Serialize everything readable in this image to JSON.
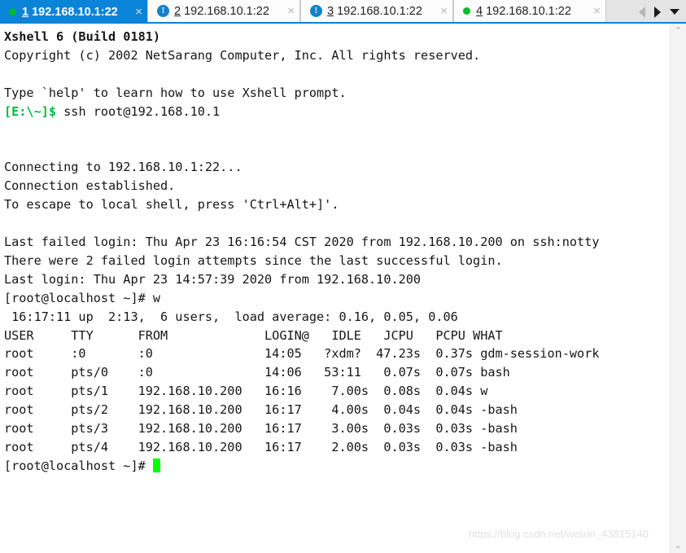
{
  "app": {
    "name": "Xshell",
    "version_line": "Xshell 6 (Build 0181)"
  },
  "tabs": [
    {
      "index": "1",
      "title": "192.168.10.1:22",
      "state": "connected",
      "icon": "green-dot-icon",
      "active": true,
      "close_label": "×"
    },
    {
      "index": "2",
      "title": "192.168.10.1:22",
      "state": "alert",
      "icon": "alert-circle-icon",
      "active": false,
      "close_label": "×"
    },
    {
      "index": "3",
      "title": "192.168.10.1:22",
      "state": "alert",
      "icon": "alert-circle-icon",
      "active": false,
      "close_label": "×"
    },
    {
      "index": "4",
      "title": "192.168.10.1:22",
      "state": "connected",
      "icon": "green-dot-icon",
      "active": false,
      "close_label": "×"
    }
  ],
  "tab_nav": {
    "prev_label": "◀",
    "next_label": "▶",
    "list_label": "▼"
  },
  "terminal": {
    "lines": [
      {
        "text": "Xshell 6 (Build 0181)",
        "style": "bold"
      },
      {
        "text": "Copyright (c) 2002 NetSarang Computer, Inc. All rights reserved.",
        "style": "normal"
      },
      {
        "text": "",
        "style": "normal"
      },
      {
        "text": "Type `help' to learn how to use Xshell prompt.",
        "style": "normal"
      },
      {
        "text": "[E:\\~]$ ",
        "style": "prompt",
        "suffix": "ssh root@192.168.10.1"
      },
      {
        "text": "",
        "style": "normal"
      },
      {
        "text": "",
        "style": "normal"
      },
      {
        "text": "Connecting to 192.168.10.1:22...",
        "style": "normal"
      },
      {
        "text": "Connection established.",
        "style": "normal"
      },
      {
        "text": "To escape to local shell, press 'Ctrl+Alt+]'.",
        "style": "normal"
      },
      {
        "text": "",
        "style": "normal"
      },
      {
        "text": "Last failed login: Thu Apr 23 16:16:54 CST 2020 from 192.168.10.200 on ssh:notty",
        "style": "normal"
      },
      {
        "text": "There were 2 failed login attempts since the last successful login.",
        "style": "normal"
      },
      {
        "text": "Last login: Thu Apr 23 14:57:39 2020 from 192.168.10.200",
        "style": "normal"
      },
      {
        "text": "[root@localhost ~]# w",
        "style": "normal"
      },
      {
        "text": " 16:17:11 up  2:13,  6 users,  load average: 0.16, 0.05, 0.06",
        "style": "normal"
      },
      {
        "text": "USER     TTY      FROM             LOGIN@   IDLE   JCPU   PCPU WHAT",
        "style": "normal"
      },
      {
        "text": "root     :0       :0               14:05   ?xdm?  47.23s  0.37s gdm-session-work",
        "style": "normal"
      },
      {
        "text": "root     pts/0    :0               14:06   53:11   0.07s  0.07s bash",
        "style": "normal"
      },
      {
        "text": "root     pts/1    192.168.10.200   16:16    7.00s  0.08s  0.04s w",
        "style": "normal"
      },
      {
        "text": "root     pts/2    192.168.10.200   16:17    4.00s  0.04s  0.04s -bash",
        "style": "normal"
      },
      {
        "text": "root     pts/3    192.168.10.200   16:17    3.00s  0.03s  0.03s -bash",
        "style": "normal"
      },
      {
        "text": "root     pts/4    192.168.10.200   16:17    2.00s  0.03s  0.03s -bash",
        "style": "normal"
      },
      {
        "text": "[root@localhost ~]# ",
        "style": "cursor"
      }
    ],
    "prompt_local": "[E:\\~]$",
    "command_ssh": "ssh root@192.168.10.1",
    "prompt_remote": "[root@localhost ~]#",
    "command_w": "w",
    "uptime_line": " 16:17:11 up  2:13,  6 users,  load average: 0.16, 0.05, 0.06",
    "w_headers": [
      "USER",
      "TTY",
      "FROM",
      "LOGIN@",
      "IDLE",
      "JCPU",
      "PCPU",
      "WHAT"
    ],
    "w_rows": [
      [
        "root",
        ":0",
        ":0",
        "14:05",
        "?xdm?",
        "47.23s",
        "0.37s",
        "gdm-session-work"
      ],
      [
        "root",
        "pts/0",
        ":0",
        "14:06",
        "53:11",
        "0.07s",
        "0.07s",
        "bash"
      ],
      [
        "root",
        "pts/1",
        "192.168.10.200",
        "16:16",
        "7.00s",
        "0.08s",
        "0.04s",
        "w"
      ],
      [
        "root",
        "pts/2",
        "192.168.10.200",
        "16:17",
        "4.00s",
        "0.04s",
        "0.04s",
        "-bash"
      ],
      [
        "root",
        "pts/3",
        "192.168.10.200",
        "16:17",
        "3.00s",
        "0.03s",
        "0.03s",
        "-bash"
      ],
      [
        "root",
        "pts/4",
        "192.168.10.200",
        "16:17",
        "2.00s",
        "0.03s",
        "0.03s",
        "-bash"
      ]
    ]
  },
  "scrollbar": {
    "up_label": "⌃",
    "down_label": "⌄"
  },
  "watermark": {
    "text": "https://blog.csdn.net/weixin_43815140"
  },
  "colors": {
    "tab_active_bg": "#0a84d8",
    "tab_inactive_bg": "#fcfcfc",
    "tab_bar_bg": "#e4e4e4",
    "connected_dot": "#00bb2d",
    "alert_icon": "#1682c8",
    "terminal_bg": "#ffffff",
    "terminal_fg": "#161616",
    "prompt_green": "#00b83c",
    "cursor_green": "#00ff00"
  }
}
